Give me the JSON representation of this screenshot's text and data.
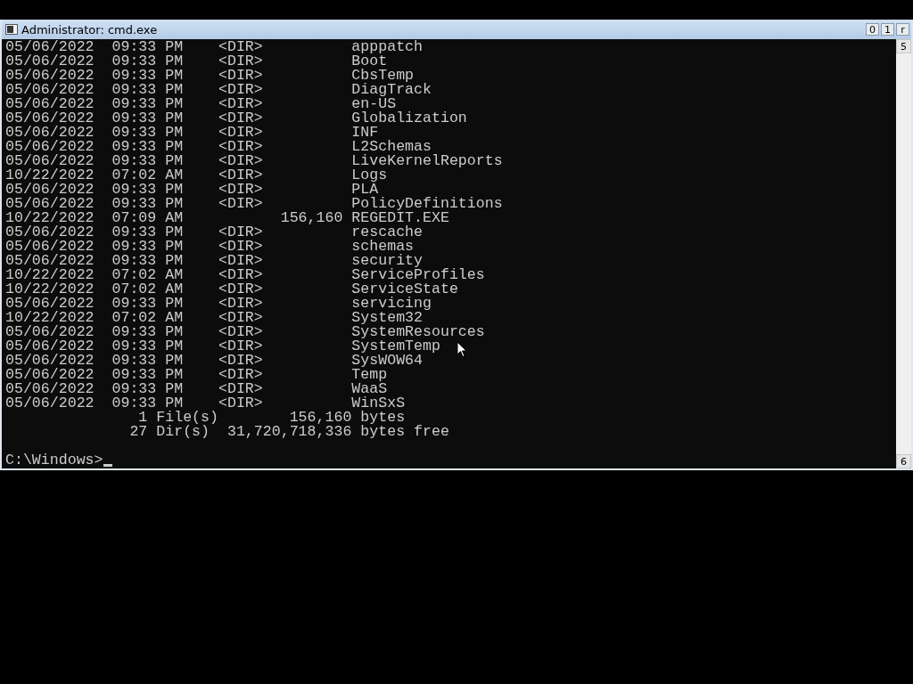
{
  "window": {
    "title": "Administrator: cmd.exe",
    "controls": [
      "0",
      "1",
      "r"
    ]
  },
  "console": {
    "lines": [
      "05/06/2022  09:33 PM    <DIR>          apppatch",
      "05/06/2022  09:33 PM    <DIR>          Boot",
      "05/06/2022  09:33 PM    <DIR>          CbsTemp",
      "05/06/2022  09:33 PM    <DIR>          DiagTrack",
      "05/06/2022  09:33 PM    <DIR>          en-US",
      "05/06/2022  09:33 PM    <DIR>          Globalization",
      "05/06/2022  09:33 PM    <DIR>          INF",
      "05/06/2022  09:33 PM    <DIR>          L2Schemas",
      "05/06/2022  09:33 PM    <DIR>          LiveKernelReports",
      "10/22/2022  07:02 AM    <DIR>          Logs",
      "05/06/2022  09:33 PM    <DIR>          PLA",
      "05/06/2022  09:33 PM    <DIR>          PolicyDefinitions",
      "10/22/2022  07:09 AM           156,160 REGEDIT.EXE",
      "05/06/2022  09:33 PM    <DIR>          rescache",
      "05/06/2022  09:33 PM    <DIR>          schemas",
      "05/06/2022  09:33 PM    <DIR>          security",
      "10/22/2022  07:02 AM    <DIR>          ServiceProfiles",
      "10/22/2022  07:02 AM    <DIR>          ServiceState",
      "05/06/2022  09:33 PM    <DIR>          servicing",
      "10/22/2022  07:02 AM    <DIR>          System32",
      "05/06/2022  09:33 PM    <DIR>          SystemResources",
      "05/06/2022  09:33 PM    <DIR>          SystemTemp",
      "05/06/2022  09:33 PM    <DIR>          SysWOW64",
      "05/06/2022  09:33 PM    <DIR>          Temp",
      "05/06/2022  09:33 PM    <DIR>          WaaS",
      "05/06/2022  09:33 PM    <DIR>          WinSxS",
      "               1 File(s)        156,160 bytes",
      "              27 Dir(s)  31,720,718,336 bytes free"
    ],
    "prompt": "C:\\Windows>"
  },
  "scrollbar": {
    "up": "5",
    "down": "6"
  }
}
